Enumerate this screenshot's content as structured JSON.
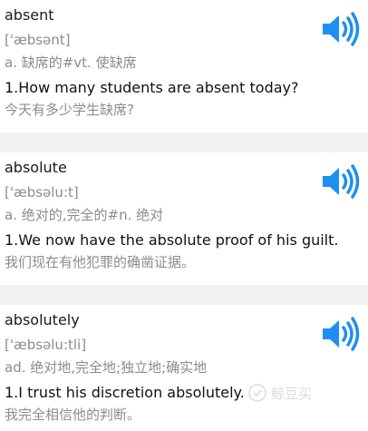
{
  "colors": {
    "speaker": "#1e8ff0",
    "background": "#f1f1f3",
    "card": "#ffffff",
    "secondary_text": "#8c8c8c"
  },
  "entries": [
    {
      "word": "absent",
      "phonetic": "['æbsənt]",
      "meaning": "a. 缺席的#vt. 使缺席",
      "example_en": "1.How many students are absent today?",
      "example_zh": "今天有多少学生缺席?",
      "speaker_icon": "speaker-icon"
    },
    {
      "word": "absolute",
      "phonetic": "['æbsəlu:t]",
      "meaning": "a. 绝对的,完全的#n. 绝对",
      "example_en": "1.We now have the absolute proof of his guilt.",
      "example_zh": "我们现在有他犯罪的确凿证据。",
      "speaker_icon": "speaker-icon"
    },
    {
      "word": "absolutely",
      "phonetic": "['æbsəlu:tli]",
      "meaning": "ad. 绝对地,完全地;独立地;确实地",
      "example_en": "1.I trust his discretion absolutely.",
      "example_zh": "我完全相信他的判断。",
      "speaker_icon": "speaker-icon"
    }
  ],
  "watermark": {
    "text": "鲸豆买"
  }
}
